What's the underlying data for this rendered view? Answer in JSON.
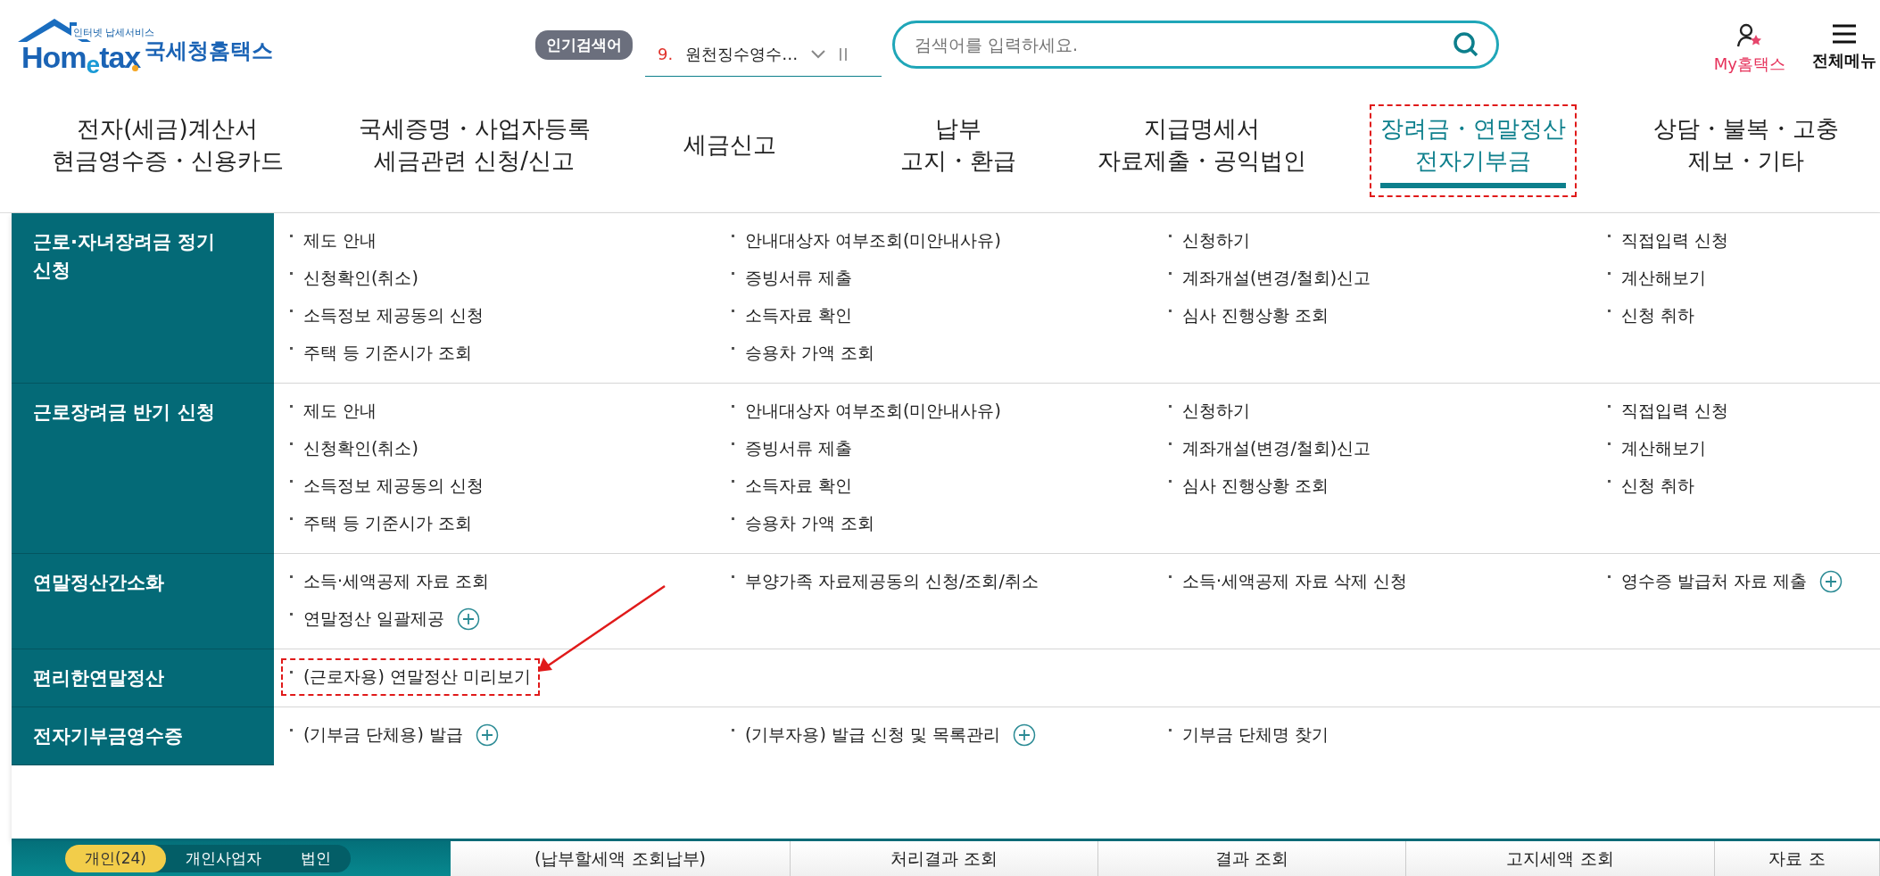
{
  "header": {
    "logo": {
      "tagline": "인터넷 납세서비스",
      "wordmark": "Hom$_{e}$tax",
      "brand": "국세청홈택스"
    },
    "popular": {
      "label": "인기검색어",
      "rank": "9.",
      "term": "원천징수영수…"
    },
    "search": {
      "placeholder": "검색어를 입력하세요."
    },
    "utilities": [
      {
        "kind": "user",
        "label": "My홈택스"
      },
      {
        "kind": "menu",
        "label": "전체메뉴"
      }
    ]
  },
  "nav": [
    {
      "lines": [
        "전자(세금)계산서",
        "현금영수증・신용카드"
      ],
      "selected": false,
      "marked": false
    },
    {
      "lines": [
        "국세증명・사업자등록",
        "세금관련 신청/신고"
      ],
      "selected": false,
      "marked": false
    },
    {
      "lines": [
        "세금신고"
      ],
      "selected": false,
      "marked": false
    },
    {
      "lines": [
        "납부",
        "고지・환급"
      ],
      "selected": false,
      "marked": false
    },
    {
      "lines": [
        "지급명세서",
        "자료제출・공익법인"
      ],
      "selected": false,
      "marked": false
    },
    {
      "lines": [
        "장려금・연말정산",
        "전자기부금"
      ],
      "selected": true,
      "marked": true
    },
    {
      "lines": [
        "상담・불복・고충",
        "제보・기타"
      ],
      "selected": false,
      "marked": false
    }
  ],
  "menu": [
    {
      "title": "근로·자녀장려금 정기 신청",
      "items": [
        {
          "label": "제도 안내",
          "plus": false,
          "marked": false
        },
        {
          "label": "안내대상자 여부조회(미안내사유)",
          "plus": false,
          "marked": false
        },
        {
          "label": "신청하기",
          "plus": false,
          "marked": false
        },
        {
          "label": "직접입력 신청",
          "plus": false,
          "marked": false
        },
        {
          "label": "신청확인(취소)",
          "plus": false,
          "marked": false
        },
        {
          "label": "증빙서류 제출",
          "plus": false,
          "marked": false
        },
        {
          "label": "계좌개설(변경/철회)신고",
          "plus": false,
          "marked": false
        },
        {
          "label": "계산해보기",
          "plus": false,
          "marked": false
        },
        {
          "label": "소득정보 제공동의 신청",
          "plus": false,
          "marked": false
        },
        {
          "label": "소득자료 확인",
          "plus": false,
          "marked": false
        },
        {
          "label": "심사 진행상황 조회",
          "plus": false,
          "marked": false
        },
        {
          "label": "신청 취하",
          "plus": false,
          "marked": false
        },
        {
          "label": "주택 등 기준시가 조회",
          "plus": false,
          "marked": false
        },
        {
          "label": "승용차 가액 조회",
          "plus": false,
          "marked": false
        }
      ]
    },
    {
      "title": "근로장려금 반기 신청",
      "items": [
        {
          "label": "제도 안내",
          "plus": false,
          "marked": false
        },
        {
          "label": "안내대상자 여부조회(미안내사유)",
          "plus": false,
          "marked": false
        },
        {
          "label": "신청하기",
          "plus": false,
          "marked": false
        },
        {
          "label": "직접입력 신청",
          "plus": false,
          "marked": false
        },
        {
          "label": "신청확인(취소)",
          "plus": false,
          "marked": false
        },
        {
          "label": "증빙서류 제출",
          "plus": false,
          "marked": false
        },
        {
          "label": "계좌개설(변경/철회)신고",
          "plus": false,
          "marked": false
        },
        {
          "label": "계산해보기",
          "plus": false,
          "marked": false
        },
        {
          "label": "소득정보 제공동의 신청",
          "plus": false,
          "marked": false
        },
        {
          "label": "소득자료 확인",
          "plus": false,
          "marked": false
        },
        {
          "label": "심사 진행상황 조회",
          "plus": false,
          "marked": false
        },
        {
          "label": "신청 취하",
          "plus": false,
          "marked": false
        },
        {
          "label": "주택 등 기준시가 조회",
          "plus": false,
          "marked": false
        },
        {
          "label": "승용차 가액 조회",
          "plus": false,
          "marked": false
        }
      ]
    },
    {
      "title": "연말정산간소화",
      "items": [
        {
          "label": "소득·세액공제 자료 조회",
          "plus": false,
          "marked": false
        },
        {
          "label": "부양가족 자료제공동의 신청/조회/취소",
          "plus": false,
          "marked": false
        },
        {
          "label": "소득·세액공제 자료 삭제 신청",
          "plus": false,
          "marked": false
        },
        {
          "label": "영수증 발급처 자료 제출",
          "plus": true,
          "marked": false
        },
        {
          "label": "연말정산 일괄제공",
          "plus": true,
          "marked": false
        }
      ]
    },
    {
      "title": "편리한연말정산",
      "items": [
        {
          "label": "(근로자용) 연말정산 미리보기",
          "plus": false,
          "marked": true
        }
      ]
    },
    {
      "title": "전자기부금영수증",
      "items": [
        {
          "label": "(기부금 단체용) 발급",
          "plus": true,
          "marked": false
        },
        {
          "label": "(기부자용) 발급 신청 및 목록관리",
          "plus": true,
          "marked": false
        },
        {
          "label": "기부금 단체명 찾기",
          "plus": false,
          "marked": false
        }
      ]
    }
  ],
  "bottom": {
    "tabs": [
      {
        "label": "개인(24)",
        "selected": true
      },
      {
        "label": "개인사업자",
        "selected": false
      },
      {
        "label": "법인",
        "selected": false
      }
    ],
    "cells": [
      "(납부할세액 조회납부)",
      "처리결과 조회",
      "결과 조회",
      "고지세액 조회",
      "자료 조"
    ]
  }
}
